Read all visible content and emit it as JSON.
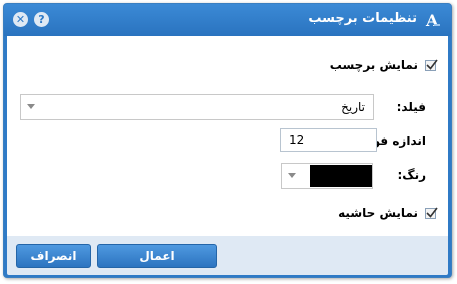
{
  "dialog": {
    "title": "تنظیمات برچسب",
    "title_icon": "label-a-icon",
    "close_icon": "close-icon",
    "help_icon": "help-icon"
  },
  "form": {
    "show_label": {
      "text": "نمایش برچسب",
      "checked": true
    },
    "field": {
      "label": "فیلد:",
      "value": "تاریخ"
    },
    "font_size": {
      "label": "اندازه فونت:",
      "value": "12"
    },
    "color": {
      "label": "رنگ:",
      "value": "#000000"
    },
    "show_border": {
      "text": "نمایش حاشیه",
      "checked": true
    }
  },
  "footer": {
    "apply_label": "اعمال",
    "cancel_label": "انصراف"
  },
  "colors": {
    "accent": "#2f7ac6",
    "footer_bg": "#dfe9f4"
  }
}
